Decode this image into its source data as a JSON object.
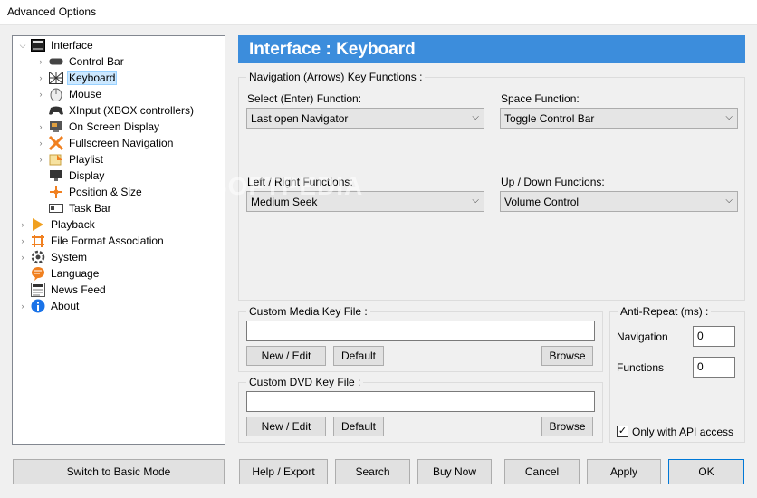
{
  "window": {
    "title": "Advanced Options"
  },
  "tree": [
    {
      "label": "Interface",
      "icon": "interface-icon",
      "level": 0
    },
    {
      "label": "Control Bar",
      "icon": "control-bar-icon",
      "level": 1
    },
    {
      "label": "Keyboard",
      "icon": "keyboard-icon",
      "level": 1,
      "selected": true
    },
    {
      "label": "Mouse",
      "icon": "mouse-icon",
      "level": 1
    },
    {
      "label": "XInput (XBOX controllers)",
      "icon": "gamepad-icon",
      "level": 1
    },
    {
      "label": "On Screen Display",
      "icon": "osd-icon",
      "level": 1
    },
    {
      "label": "Fullscreen Navigation",
      "icon": "fullscreen-icon",
      "level": 1
    },
    {
      "label": "Playlist",
      "icon": "playlist-icon",
      "level": 1
    },
    {
      "label": "Display",
      "icon": "display-icon",
      "level": 1
    },
    {
      "label": "Position & Size",
      "icon": "position-icon",
      "level": 1
    },
    {
      "label": "Task Bar",
      "icon": "taskbar-icon",
      "level": 1
    },
    {
      "label": "Playback",
      "icon": "playback-icon",
      "level": 0
    },
    {
      "label": "File Format Association",
      "icon": "file-format-icon",
      "level": 0
    },
    {
      "label": "System",
      "icon": "system-gear-icon",
      "level": 0
    },
    {
      "label": "Language",
      "icon": "language-icon",
      "level": 0
    },
    {
      "label": "News Feed",
      "icon": "news-icon",
      "level": 0
    },
    {
      "label": "About",
      "icon": "info-icon",
      "level": 0
    }
  ],
  "header": {
    "title": "Interface : Keyboard"
  },
  "navigation_group": {
    "legend": "Navigation (Arrows) Key Functions :",
    "select_label": "Select (Enter) Function:",
    "select_value": "Last open Navigator",
    "space_label": "Space Function:",
    "space_value": "Toggle Control Bar",
    "leftright_label": "Left / Right Functions:",
    "leftright_value": "Medium Seek",
    "updown_label": "Up / Down Functions:",
    "updown_value": "Volume Control"
  },
  "media_key_group": {
    "legend": "Custom Media Key File :",
    "value": "",
    "new_edit": "New / Edit",
    "default": "Default",
    "browse": "Browse"
  },
  "dvd_key_group": {
    "legend": "Custom DVD Key File :",
    "value": "",
    "new_edit": "New / Edit",
    "default": "Default",
    "browse": "Browse"
  },
  "anti_repeat": {
    "legend": "Anti-Repeat (ms) :",
    "navigation_label": "Navigation",
    "navigation_value": "0",
    "functions_label": "Functions",
    "functions_value": "0",
    "api_only_label": "Only with API access",
    "api_only_checked": true
  },
  "footer": {
    "basic_mode": "Switch to Basic Mode",
    "help_export": "Help / Export",
    "search": "Search",
    "buy_now": "Buy Now",
    "cancel": "Cancel",
    "apply": "Apply",
    "ok": "OK"
  },
  "watermark": "SOFTPEDIA",
  "colors": {
    "header_bg": "#3c8ddc",
    "selection_bg": "#cce8ff",
    "accent": "#0078d7"
  }
}
